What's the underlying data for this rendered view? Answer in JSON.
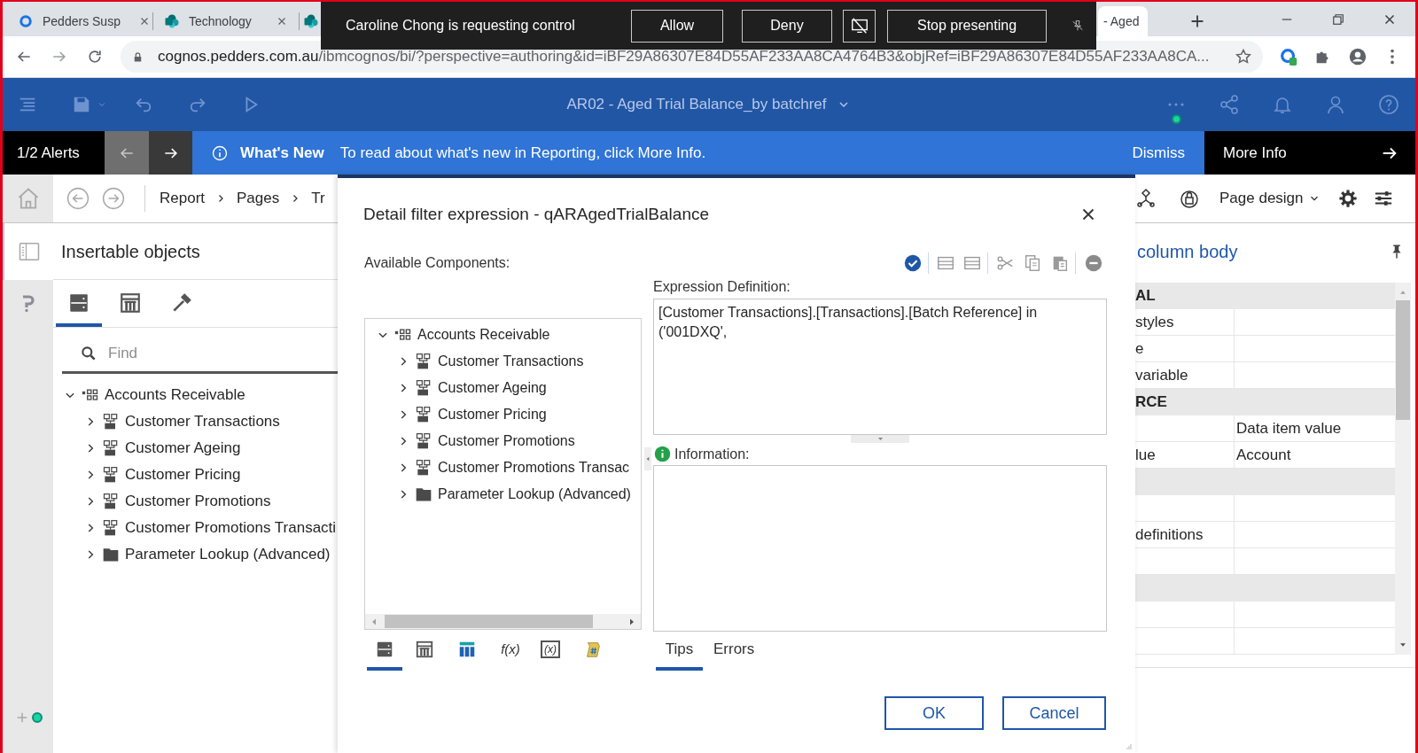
{
  "browser": {
    "tabs": [
      {
        "kind": "ring",
        "title": "Pedders Susp",
        "selected": false
      },
      {
        "kind": "sharepoint",
        "title": "Technology",
        "selected": false
      },
      {
        "kind": "sharepoint",
        "selected": false
      },
      {
        "kind": "plain",
        "title": "- Aged",
        "selected": true
      }
    ],
    "url_host": "cognos.pedders.com.au",
    "url_path": "/ibmcognos/bi/?perspective=authoring&id=iBF29A86307E84D55AF233AA8CA4764B3&objRef=iBF29A86307E84D55AF233AA8CA..."
  },
  "presenting_bar": {
    "message": "Caroline Chong is requesting control",
    "buttons": [
      "Allow",
      "Deny"
    ],
    "stop_label": "Stop presenting"
  },
  "app_bar": {
    "title": "AR02 - Aged Trial Balance_by batchref"
  },
  "alert": {
    "counter": "1/2 Alerts",
    "previous_disabled": true,
    "next_disabled": false,
    "heading": "What's New",
    "message": "To read about what's new in Reporting, click More Info.",
    "dismiss": "Dismiss",
    "more": "More Info"
  },
  "rail": [
    {
      "selected": true
    },
    {
      "selected": false
    }
  ],
  "breadcrumb": [
    "Report",
    "Pages",
    "Tr"
  ],
  "insertable": {
    "title": "Insertable objects",
    "tabs": [
      {
        "selected": true
      },
      {
        "selected": false
      },
      {
        "selected": false
      }
    ],
    "search": {
      "placeholder": "Find"
    },
    "tree": [
      {
        "kind": "package",
        "label": "Accounts Receivable",
        "expanded": true,
        "children": [
          {
            "kind": "namespace",
            "label": "Customer Transactions",
            "expanded": false
          },
          {
            "kind": "namespace",
            "label": "Customer Ageing",
            "expanded": false
          },
          {
            "kind": "namespace",
            "label": "Customer Pricing",
            "expanded": false
          },
          {
            "kind": "namespace",
            "label": "Customer Promotions",
            "expanded": false
          },
          {
            "kind": "namespace",
            "label": "Customer Promotions Transacti",
            "expanded": false
          },
          {
            "kind": "folder",
            "label": "Parameter Lookup (Advanced)",
            "expanded": false
          }
        ]
      }
    ]
  },
  "dialog": {
    "title": "Detail filter expression - qARAgedTrialBalance",
    "components_label": "Available Components:",
    "tree": [
      {
        "kind": "package",
        "label": "Accounts Receivable",
        "expanded": true,
        "children": [
          {
            "kind": "namespace",
            "label": "Customer Transactions",
            "expanded": false
          },
          {
            "kind": "namespace",
            "label": "Customer Ageing",
            "expanded": false
          },
          {
            "kind": "namespace",
            "label": "Customer Pricing",
            "expanded": false
          },
          {
            "kind": "namespace",
            "label": "Customer Promotions",
            "expanded": false
          },
          {
            "kind": "namespace",
            "label": "Customer Promotions Transac",
            "expanded": false
          },
          {
            "kind": "folder",
            "label": "Parameter Lookup (Advanced)",
            "expanded": false
          }
        ]
      }
    ],
    "expression_label": "Expression Definition:",
    "expression": "[Customer Transactions].[Transactions].[Batch Reference] in ('001DXQ',",
    "information_label": "Information:",
    "source_tabs": [
      {
        "selected": true
      },
      {
        "selected": false
      },
      {
        "selected": false
      },
      {
        "label": "f(x)",
        "selected": false
      },
      {
        "label": "(x)",
        "selected": false
      },
      {
        "selected": false
      }
    ],
    "info_tabs": [
      {
        "label": "Tips",
        "selected": true
      },
      {
        "label": "Errors",
        "selected": false
      }
    ],
    "buttons": [
      "OK",
      "Cancel"
    ]
  },
  "properties": {
    "page_design": "Page design",
    "title": "column body",
    "rows": [
      {
        "kind": "section",
        "label": "AL"
      },
      {
        "kind": "property",
        "name": "styles"
      },
      {
        "kind": "property",
        "name": "e"
      },
      {
        "kind": "property",
        "name": "variable"
      },
      {
        "kind": "section",
        "label": "RCE"
      },
      {
        "kind": "property",
        "value": "Data item value"
      },
      {
        "kind": "property",
        "name": "lue",
        "value": "Account"
      },
      {
        "kind": "section"
      },
      {
        "kind": "property"
      },
      {
        "kind": "property",
        "name": "definitions"
      },
      {
        "kind": "property"
      },
      {
        "kind": "section"
      },
      {
        "kind": "property"
      },
      {
        "kind": "property"
      }
    ]
  }
}
